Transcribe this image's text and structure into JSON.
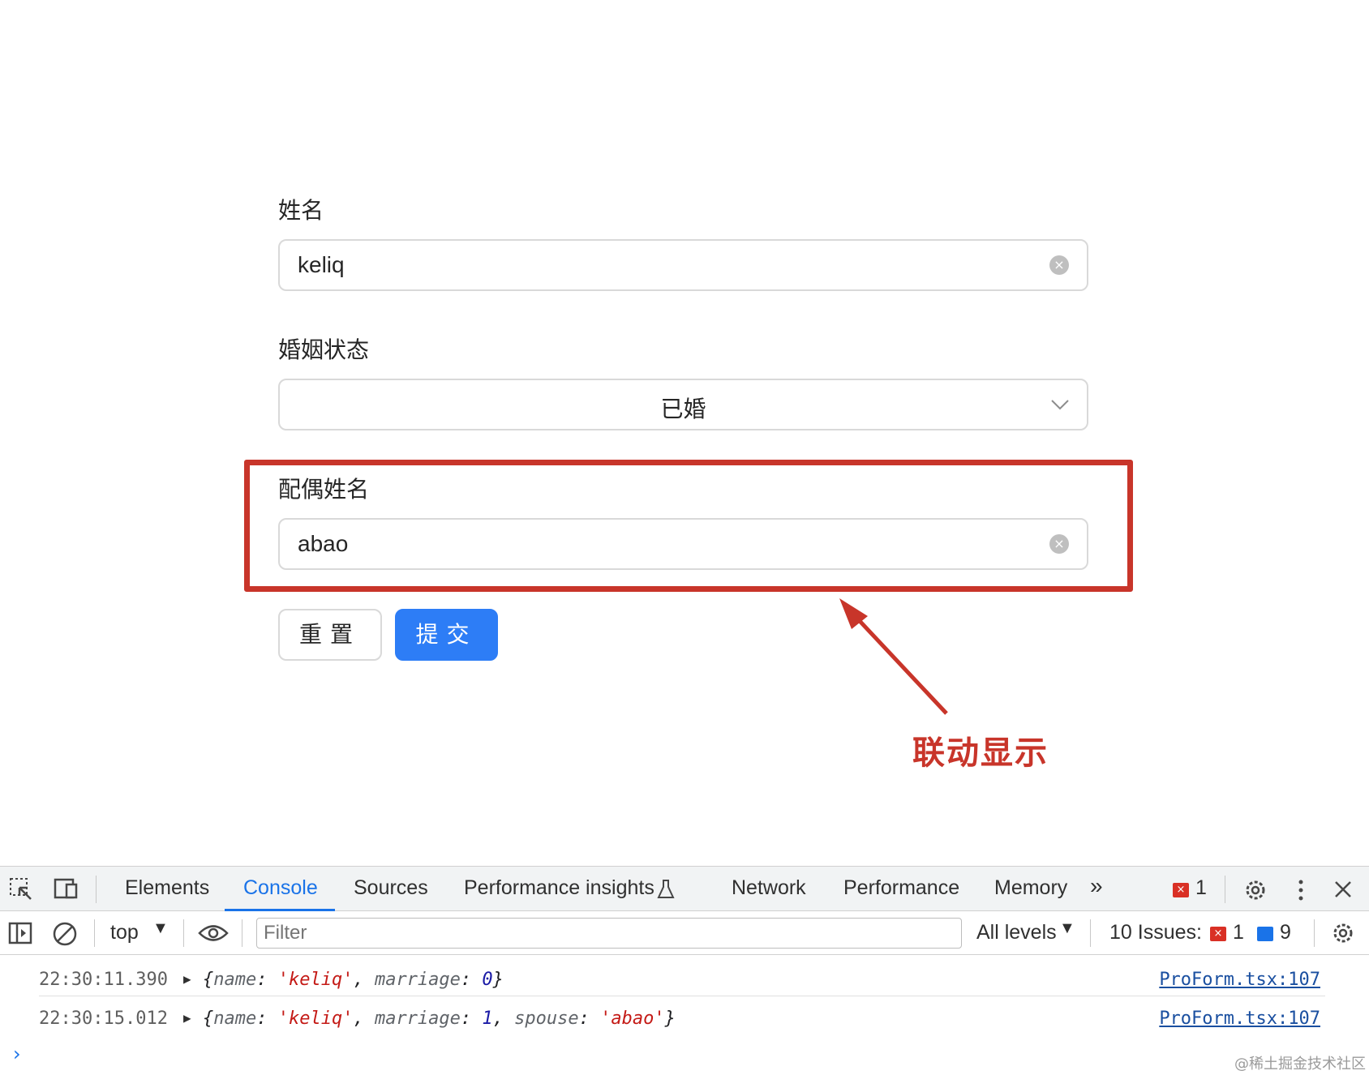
{
  "form": {
    "name_label": "姓名",
    "name_value": "keliq",
    "marriage_label": "婚姻状态",
    "marriage_value": "已婚",
    "spouse_label": "配偶姓名",
    "spouse_value": "abao",
    "reset_label": "重置",
    "submit_label": "提交"
  },
  "annotation": {
    "text": "联动显示",
    "color": "#c8352a"
  },
  "devtools": {
    "tabs": [
      "Elements",
      "Console",
      "Sources",
      "Performance insights",
      "Network",
      "Performance",
      "Memory"
    ],
    "active_tab": "Console",
    "error_count": "1",
    "context": "top",
    "filter_placeholder": "Filter",
    "levels": "All levels",
    "issues_label": "10 Issues:",
    "issues_errors": "1",
    "issues_info": "9",
    "logs": [
      {
        "time": "22:30:11.390",
        "name": "'keliq'",
        "marriage": "0",
        "source": "ProForm.tsx:107"
      },
      {
        "time": "22:30:15.012",
        "name": "'keliq'",
        "marriage": "1",
        "spouse": "'abao'",
        "source": "ProForm.tsx:107"
      }
    ],
    "accent": "#1a73e8"
  },
  "watermark": "@稀土掘金技术社区"
}
